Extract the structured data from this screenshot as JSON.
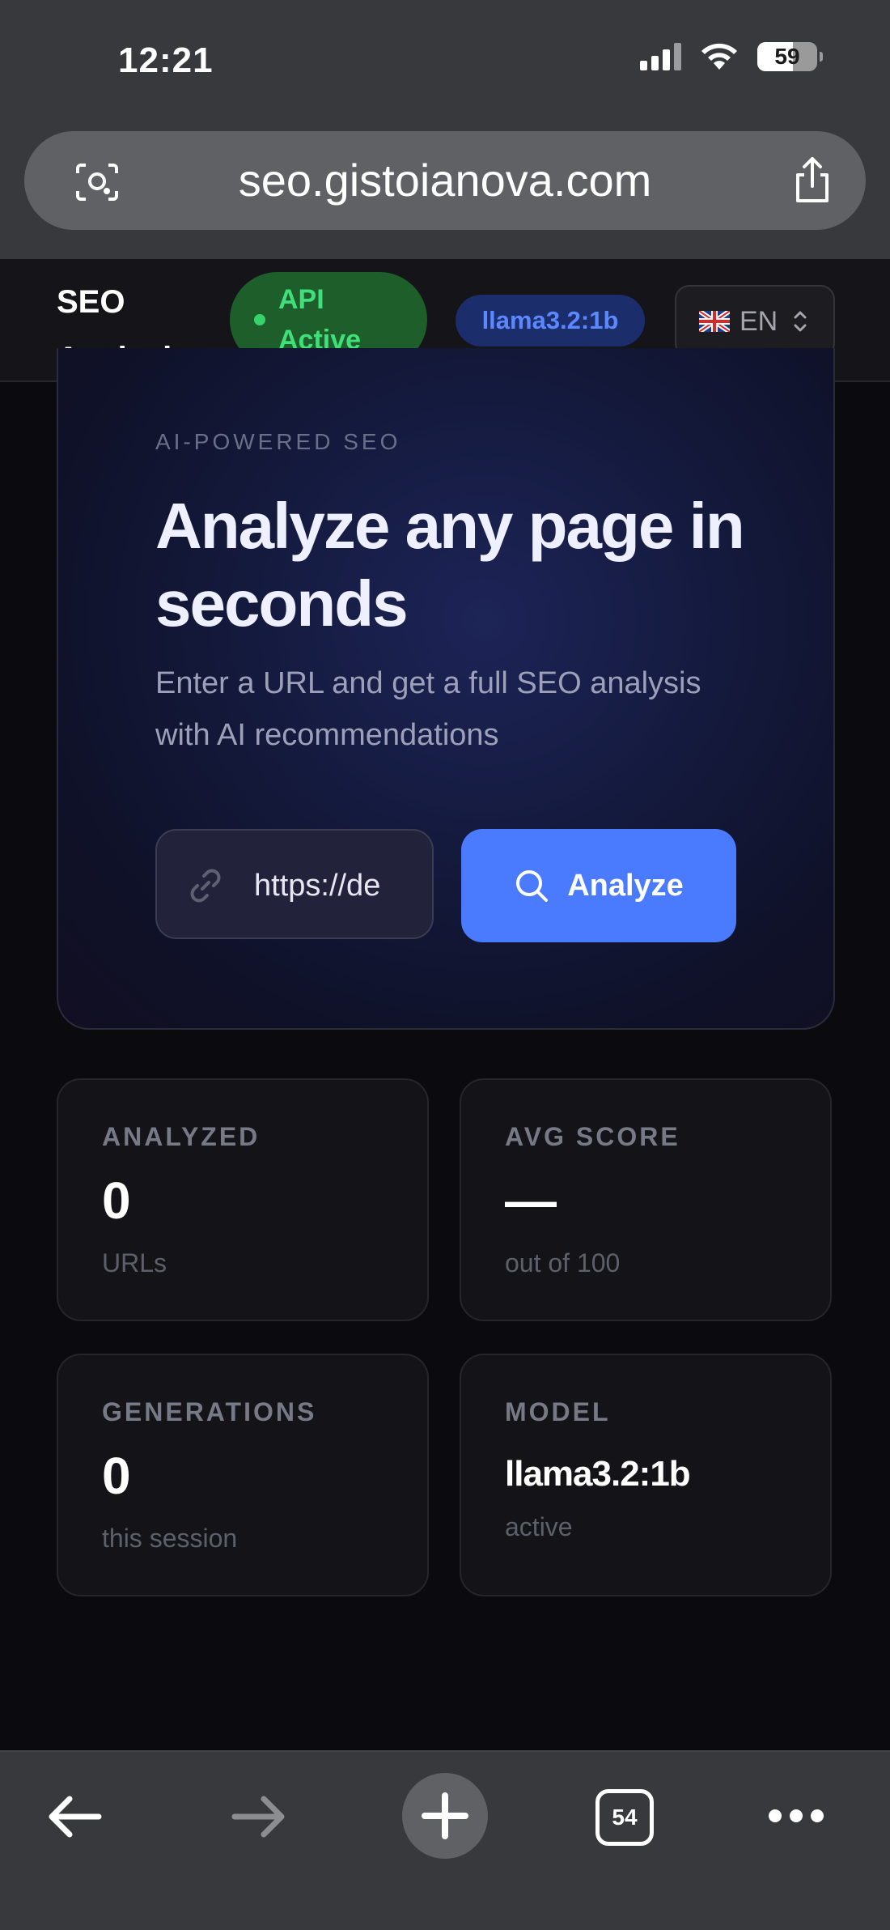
{
  "status_bar": {
    "time": "12:21",
    "battery": "59"
  },
  "browser": {
    "url": "seo.gistoianova.com",
    "tab_count": "54"
  },
  "header": {
    "brand_line1": "SEO",
    "brand_line2": "Analysis",
    "api_status_line1": "API",
    "api_status_line2": "Active",
    "model_badge": "llama3.2:1b",
    "language": "EN"
  },
  "hero": {
    "eyebrow": "AI-POWERED SEO",
    "headline": "Analyze any page in seconds",
    "subtext": "Enter a URL and get a full SEO analysis with AI recommendations",
    "url_value": "https://de",
    "analyze_label": "Analyze"
  },
  "stats": [
    {
      "label": "ANALYZED",
      "value": "0",
      "sub": "URLs"
    },
    {
      "label": "AVG SCORE",
      "value": "—",
      "sub": "out of 100"
    },
    {
      "label": "GENERATIONS",
      "value": "0",
      "sub": "this session"
    },
    {
      "label": "MODEL",
      "value": "llama3.2:1b",
      "sub": "active"
    }
  ],
  "colors": {
    "accent": "#4a7bff",
    "api_active": "#3fe07a",
    "model_badge": "#5b87ff"
  },
  "icons": [
    "lens-icon",
    "share-icon",
    "flag-uk-icon",
    "chevron-updown-icon",
    "link-icon",
    "search-icon",
    "back-arrow-icon",
    "forward-arrow-icon",
    "plus-icon",
    "tabs-icon",
    "more-icon"
  ]
}
